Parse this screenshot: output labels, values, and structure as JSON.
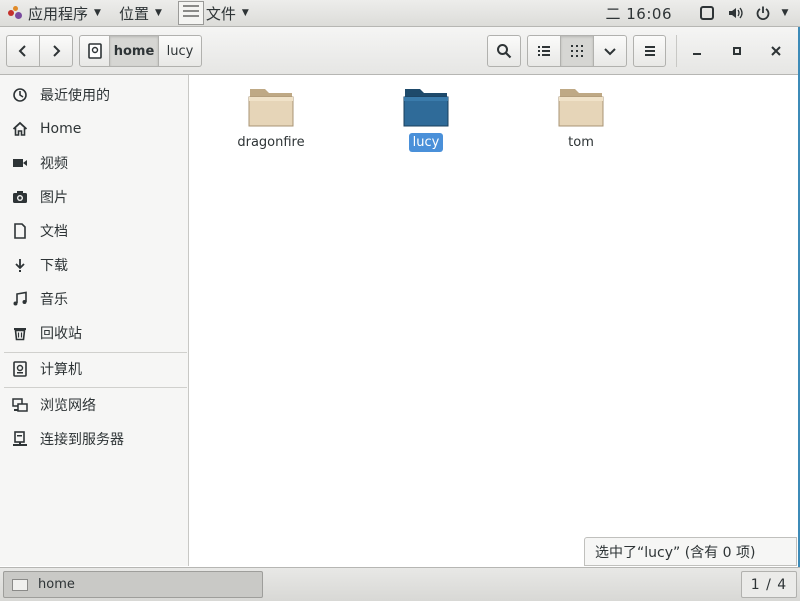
{
  "top_panel": {
    "applications_label": "应用程序",
    "places_label": "位置",
    "window_menu_label": "文件",
    "clock": "二 16:06"
  },
  "headerbar": {
    "breadcrumbs": [
      "home",
      "lucy"
    ]
  },
  "sidebar": {
    "items": [
      {
        "label": "最近使用的",
        "icon": "clock-icon"
      },
      {
        "label": "Home",
        "icon": "home-icon"
      },
      {
        "label": "视频",
        "icon": "video-icon"
      },
      {
        "label": "图片",
        "icon": "camera-icon"
      },
      {
        "label": "文档",
        "icon": "document-icon"
      },
      {
        "label": "下载",
        "icon": "download-icon"
      },
      {
        "label": "音乐",
        "icon": "music-icon"
      },
      {
        "label": "回收站",
        "icon": "trash-icon"
      },
      {
        "label": "计算机",
        "icon": "drive-icon"
      },
      {
        "label": "浏览网络",
        "icon": "network-icon"
      },
      {
        "label": "连接到服务器",
        "icon": "server-icon"
      }
    ]
  },
  "content": {
    "files": [
      {
        "name": "dragonfire",
        "selected": false
      },
      {
        "name": "lucy",
        "selected": true
      },
      {
        "name": "tom",
        "selected": false
      }
    ],
    "status": "选中了“lucy” (含有 0 项)"
  },
  "colors": {
    "folder": "#d9c7a8",
    "folder_selected": "#2f6b99",
    "selection": "#4a90d9"
  },
  "bottom_panel": {
    "task_label": "home",
    "workspace": "1 / 4"
  }
}
